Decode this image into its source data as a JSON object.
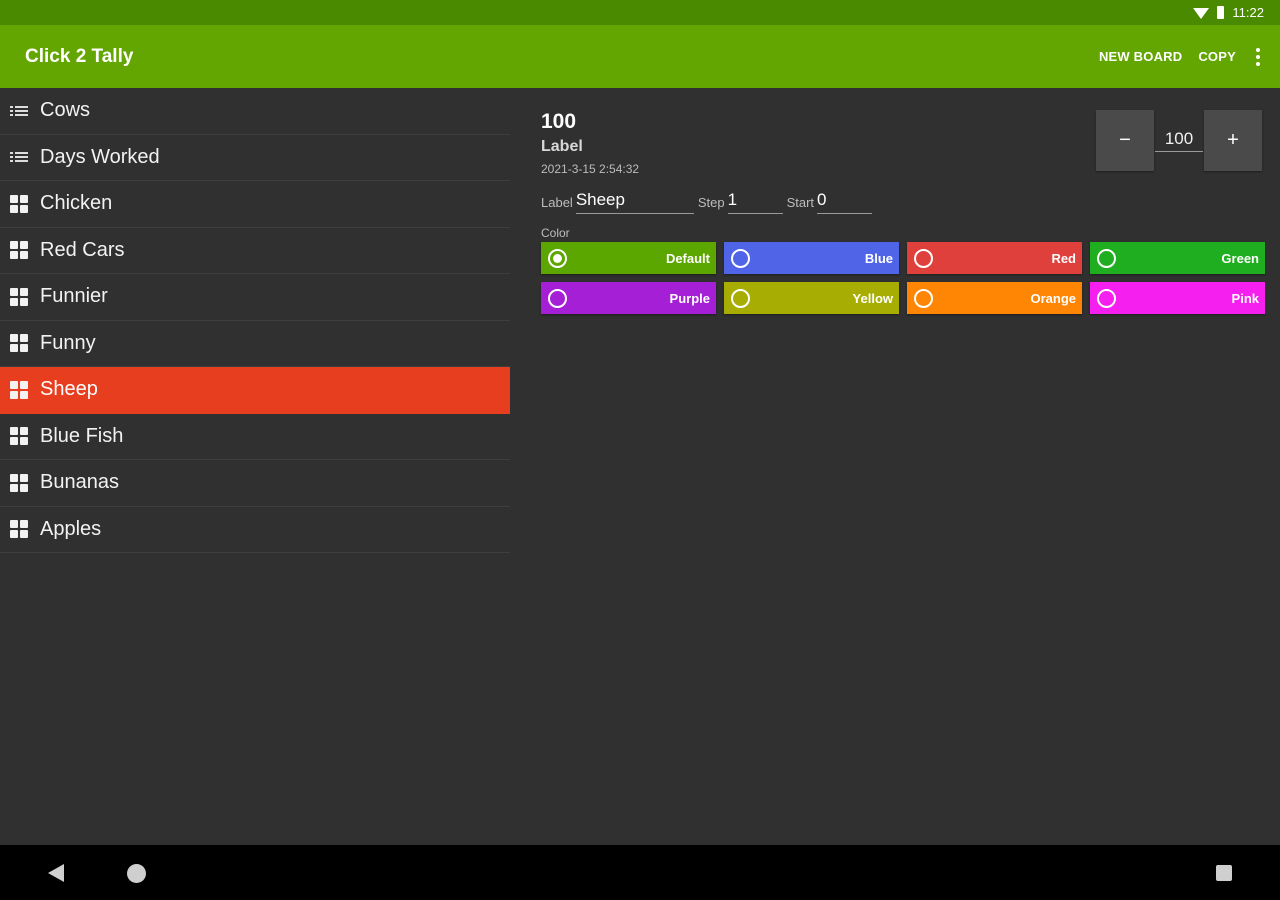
{
  "status": {
    "time": "11:22"
  },
  "appbar": {
    "title": "Click 2 Tally",
    "new_board": "NEW BOARD",
    "copy": "COPY"
  },
  "sidebar": {
    "items": [
      {
        "label": "Cows",
        "icon": "list-icon"
      },
      {
        "label": "Days Worked",
        "icon": "list-icon"
      },
      {
        "label": "Chicken",
        "icon": "grid-icon"
      },
      {
        "label": "Red Cars",
        "icon": "grid-icon"
      },
      {
        "label": "Funnier",
        "icon": "grid-icon"
      },
      {
        "label": "Funny",
        "icon": "grid-icon"
      },
      {
        "label": "Sheep",
        "icon": "grid-icon",
        "selected": true
      },
      {
        "label": "Blue Fish",
        "icon": "grid-icon"
      },
      {
        "label": "Bunanas",
        "icon": "grid-icon"
      },
      {
        "label": "Apples",
        "icon": "grid-icon"
      }
    ],
    "selected_color": "#e73e1f"
  },
  "detail": {
    "count": "100",
    "label": "Label",
    "timestamp": "2021-3-15 2:54:32",
    "stepper": {
      "minus": "−",
      "value": "100",
      "plus": "+"
    },
    "fields": {
      "label_caption": "Label",
      "label_value": "Sheep",
      "step_caption": "Step",
      "step_value": "1",
      "start_caption": "Start",
      "start_value": "0"
    },
    "color_caption": "Color",
    "colors": [
      {
        "name": "Default",
        "hex": "#5ca600",
        "checked": true
      },
      {
        "name": "Blue",
        "hex": "#5064e8",
        "checked": false
      },
      {
        "name": "Red",
        "hex": "#e0403c",
        "checked": false
      },
      {
        "name": "Green",
        "hex": "#1fae1f",
        "checked": false
      },
      {
        "name": "Purple",
        "hex": "#a51fd6",
        "checked": false
      },
      {
        "name": "Yellow",
        "hex": "#a7ad03",
        "checked": false
      },
      {
        "name": "Orange",
        "hex": "#ff8605",
        "checked": false
      },
      {
        "name": "Pink",
        "hex": "#f51ff0",
        "checked": false
      }
    ]
  },
  "theme": {
    "statusbar": "#4a8a00",
    "appbar": "#63a601",
    "background": "#303030"
  }
}
